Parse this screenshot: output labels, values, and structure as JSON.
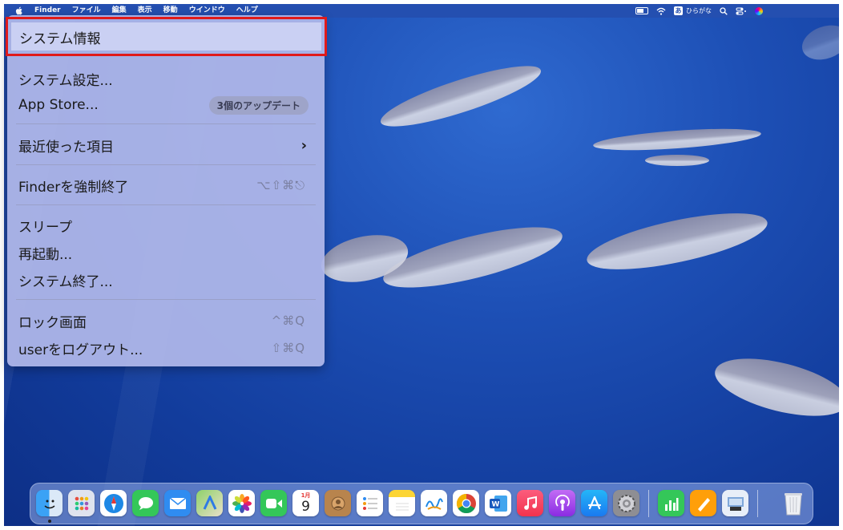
{
  "menubar": {
    "app": "Finder",
    "items": [
      "ファイル",
      "編集",
      "表示",
      "移動",
      "ウインドウ",
      "ヘルプ"
    ],
    "ime_char": "あ",
    "ime_label": "ひらがな"
  },
  "apple_menu": {
    "highlighted": "システム情報",
    "items": {
      "system_settings": "システム設定...",
      "app_store": "App Store...",
      "app_store_badge": "3個のアップデート",
      "recent_items": "最近使った項目",
      "force_quit": "Finderを強制終了",
      "force_quit_shortcut": "⌥⇧⌘⎋",
      "sleep": "スリープ",
      "restart": "再起動...",
      "shutdown": "システム終了...",
      "lock_screen": "ロック画面",
      "lock_shortcut": "^⌘Q",
      "logout": "userをログアウト...",
      "logout_shortcut": "⇧⌘Q"
    },
    "chevron": "›"
  },
  "dock": {
    "calendar_month": "1月",
    "calendar_day": "9",
    "icons": [
      "finder-icon",
      "launchpad-icon",
      "safari-icon",
      "messages-icon",
      "mail-icon",
      "maps-icon",
      "photos-icon",
      "facetime-icon",
      "calendar-icon",
      "contacts-icon",
      "reminders-icon",
      "notes-icon",
      "freeform-icon",
      "chrome-icon",
      "word-icon",
      "music-icon",
      "podcasts-icon",
      "app-store-icon",
      "system-settings-icon",
      "numbers-icon",
      "pages-icon",
      "preview-icon",
      "trash-icon"
    ]
  }
}
